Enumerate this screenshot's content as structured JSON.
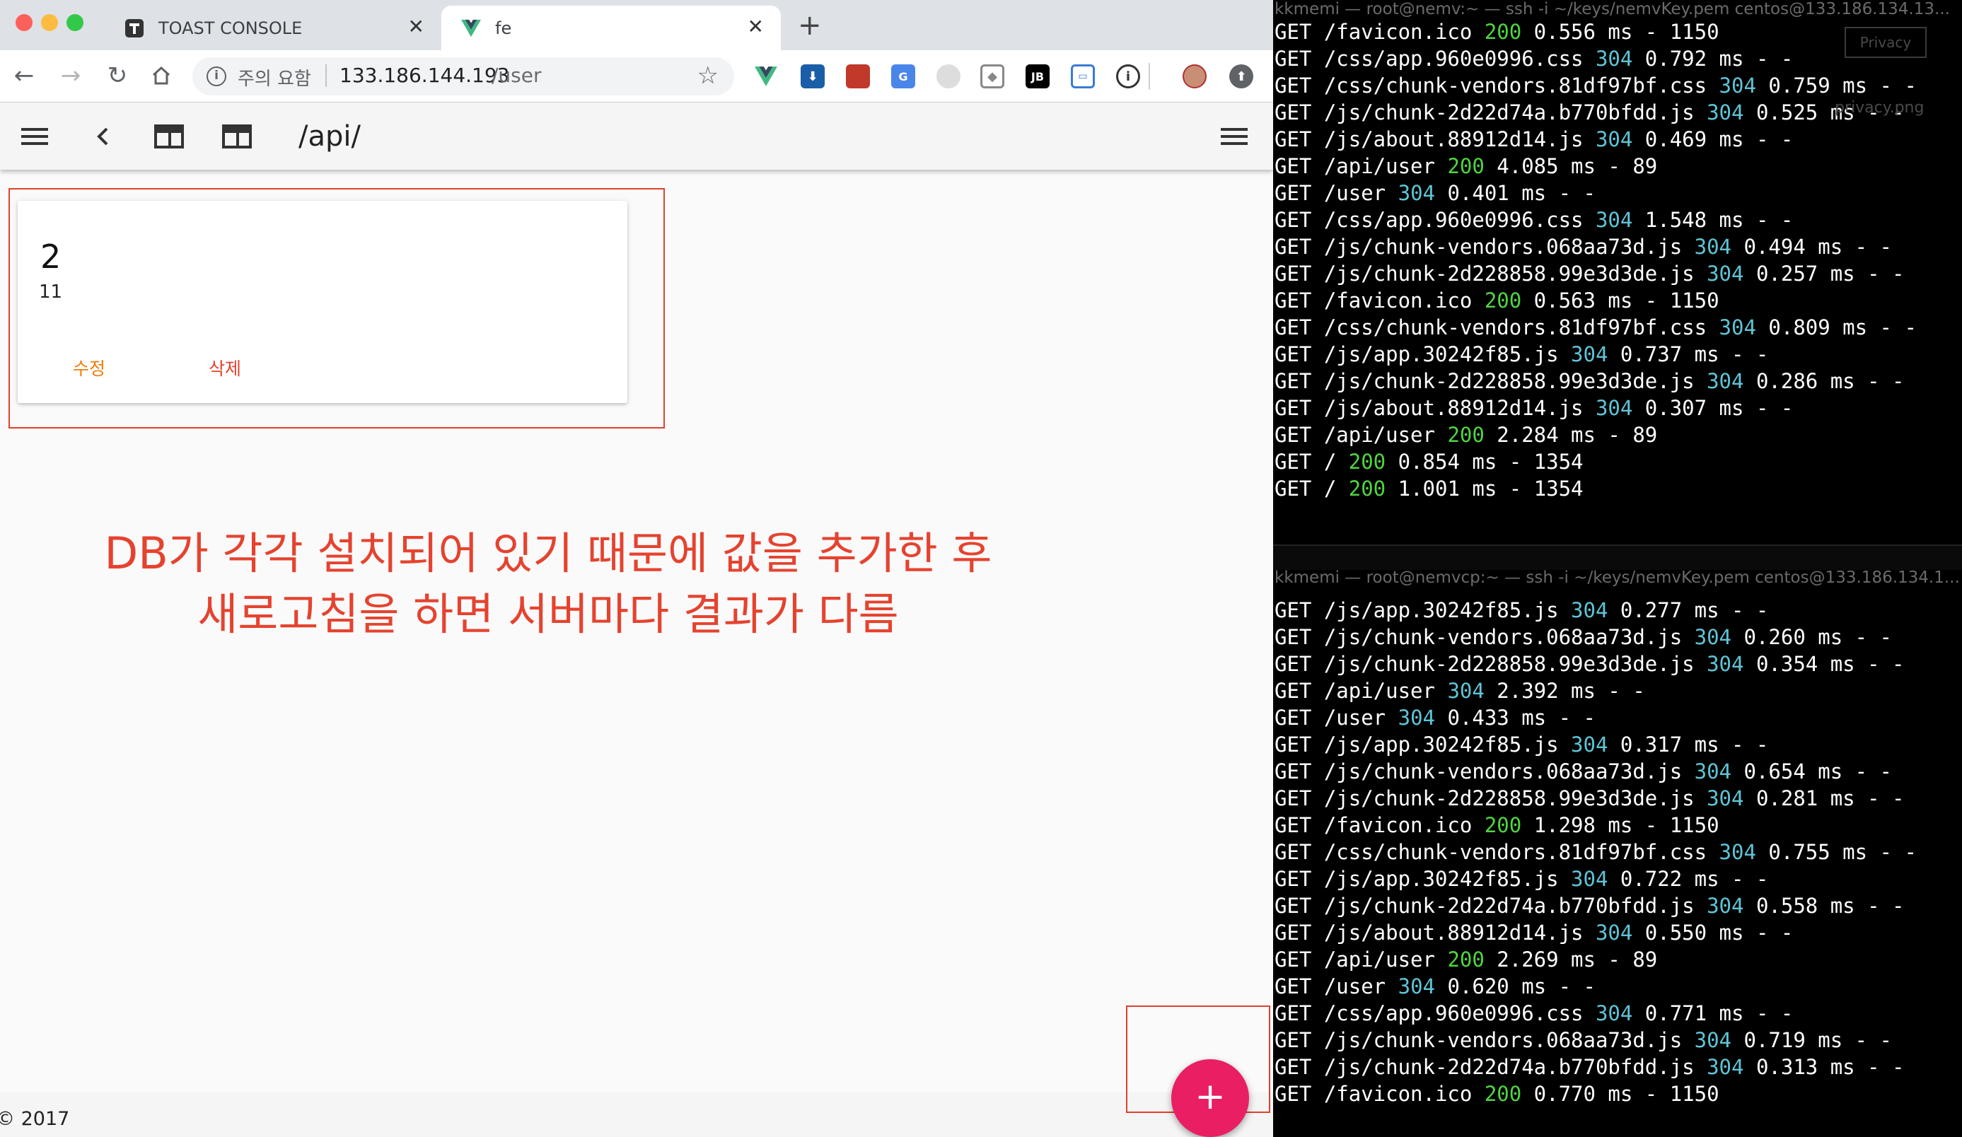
{
  "browser": {
    "tabs": [
      {
        "title": "TOAST CONSOLE",
        "icon": "toast-favicon"
      },
      {
        "title": "fe",
        "icon": "vue-favicon"
      }
    ],
    "address": {
      "security": "주의 요함",
      "host": "133.186.144.193",
      "path": "/user"
    }
  },
  "app": {
    "title": "/api/",
    "card": {
      "name": "2",
      "value": "11",
      "edit_label": "수정",
      "delete_label": "삭제"
    },
    "annotation": [
      "DB가 각각 설치되어 있기 때문에 값을 추가한 후",
      "새로고침을 하면 서버마다 결과가 다름"
    ],
    "footer": "© 2017",
    "fab": "+",
    "colors": {
      "accent": "#e91e63",
      "action": "#ef7c0a",
      "annotation": "#e5432f"
    }
  },
  "terminal_top": {
    "title": "kkmemi — root@nemv:~ — ssh -i ~/keys/nemvKey.pem centos@133.186.134.13...",
    "overlay_label": "Privacy",
    "overlay_file": "privacy.png",
    "lines": [
      {
        "a": "GET /favicon.ico ",
        "s": "200",
        "b": " 0.556 ms - 1150"
      },
      {
        "a": "GET /css/app.960e0996.css ",
        "s": "304",
        "b": " 0.792 ms - -"
      },
      {
        "a": "GET /css/chunk-vendors.81df97bf.css ",
        "s": "304",
        "b": " 0.759 ms - -"
      },
      {
        "a": "GET /js/chunk-2d22d74a.b770bfdd.js ",
        "s": "304",
        "b": " 0.525 ms - -"
      },
      {
        "a": "GET /js/about.88912d14.js ",
        "s": "304",
        "b": " 0.469 ms - -"
      },
      {
        "a": "GET /api/user ",
        "s": "200",
        "b": " 4.085 ms - 89"
      },
      {
        "a": "GET /user ",
        "s": "304",
        "b": " 0.401 ms - -"
      },
      {
        "a": "GET /css/app.960e0996.css ",
        "s": "304",
        "b": " 1.548 ms - -"
      },
      {
        "a": "GET /js/chunk-vendors.068aa73d.js ",
        "s": "304",
        "b": " 0.494 ms - -"
      },
      {
        "a": "GET /js/chunk-2d228858.99e3d3de.js ",
        "s": "304",
        "b": " 0.257 ms - -"
      },
      {
        "a": "GET /favicon.ico ",
        "s": "200",
        "b": " 0.563 ms - 1150"
      },
      {
        "a": "GET /css/chunk-vendors.81df97bf.css ",
        "s": "304",
        "b": " 0.809 ms - -"
      },
      {
        "a": "GET /js/app.30242f85.js ",
        "s": "304",
        "b": " 0.737 ms - -"
      },
      {
        "a": "GET /js/chunk-2d228858.99e3d3de.js ",
        "s": "304",
        "b": " 0.286 ms - -"
      },
      {
        "a": "GET /js/about.88912d14.js ",
        "s": "304",
        "b": " 0.307 ms - -"
      },
      {
        "a": "GET /api/user ",
        "s": "200",
        "b": " 2.284 ms - 89"
      },
      {
        "a": "GET / ",
        "s": "200",
        "b": " 0.854 ms - 1354"
      },
      {
        "a": "GET / ",
        "s": "200",
        "b": " 1.001 ms - 1354"
      }
    ]
  },
  "terminal_bottom": {
    "title": "kkmemi — root@nemvcp:~ — ssh -i ~/keys/nemvKey.pem centos@133.186.134.1...",
    "lines": [
      {
        "a": "GET /js/app.30242f85.js ",
        "s": "304",
        "b": " 0.277 ms - -"
      },
      {
        "a": "GET /js/chunk-vendors.068aa73d.js ",
        "s": "304",
        "b": " 0.260 ms - -"
      },
      {
        "a": "GET /js/chunk-2d228858.99e3d3de.js ",
        "s": "304",
        "b": " 0.354 ms - -"
      },
      {
        "a": "GET /api/user ",
        "s": "304",
        "b": " 2.392 ms - -"
      },
      {
        "a": "GET /user ",
        "s": "304",
        "b": " 0.433 ms - -"
      },
      {
        "a": "GET /js/app.30242f85.js ",
        "s": "304",
        "b": " 0.317 ms - -"
      },
      {
        "a": "GET /js/chunk-vendors.068aa73d.js ",
        "s": "304",
        "b": " 0.654 ms - -"
      },
      {
        "a": "GET /js/chunk-2d228858.99e3d3de.js ",
        "s": "304",
        "b": " 0.281 ms - -"
      },
      {
        "a": "GET /favicon.ico ",
        "s": "200",
        "b": " 1.298 ms - 1150"
      },
      {
        "a": "GET /css/chunk-vendors.81df97bf.css ",
        "s": "304",
        "b": " 0.755 ms - -"
      },
      {
        "a": "GET /js/app.30242f85.js ",
        "s": "304",
        "b": " 0.722 ms - -"
      },
      {
        "a": "GET /js/chunk-2d22d74a.b770bfdd.js ",
        "s": "304",
        "b": " 0.558 ms - -"
      },
      {
        "a": "GET /js/about.88912d14.js ",
        "s": "304",
        "b": " 0.550 ms - -"
      },
      {
        "a": "GET /api/user ",
        "s": "200",
        "b": " 2.269 ms - 89"
      },
      {
        "a": "GET /user ",
        "s": "304",
        "b": " 0.620 ms - -"
      },
      {
        "a": "GET /css/app.960e0996.css ",
        "s": "304",
        "b": " 0.771 ms - -"
      },
      {
        "a": "GET /js/chunk-vendors.068aa73d.js ",
        "s": "304",
        "b": " 0.719 ms - -"
      },
      {
        "a": "GET /js/chunk-2d22d74a.b770bfdd.js ",
        "s": "304",
        "b": " 0.313 ms - -"
      },
      {
        "a": "GET /favicon.ico ",
        "s": "200",
        "b": " 0.770 ms - 1150"
      }
    ]
  }
}
